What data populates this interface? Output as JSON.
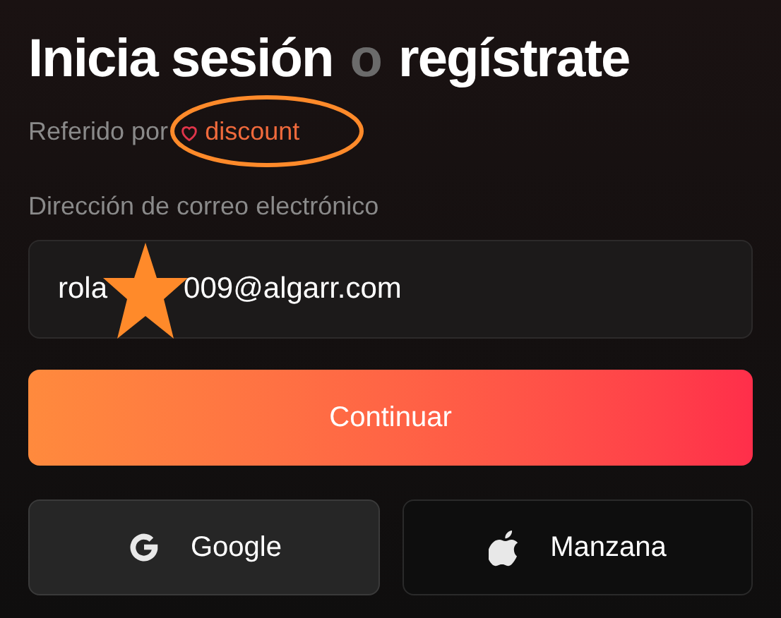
{
  "title": [
    {
      "text": "Inicia sesión",
      "kind": "main"
    },
    {
      "text": "o",
      "kind": "muted"
    },
    {
      "text": "regístrate",
      "kind": "main"
    }
  ],
  "referral": {
    "label": "Referido por",
    "code": "discount",
    "circled": true
  },
  "email": {
    "label": "Dirección de correo electrónico",
    "value_start": "rola",
    "value_end": "009@algarr.com",
    "starred": true
  },
  "primary_button": "Continuar",
  "social_buttons": [
    {
      "kind": "google",
      "label": "Google"
    },
    {
      "kind": "apple",
      "label": "Manzana"
    }
  ]
}
